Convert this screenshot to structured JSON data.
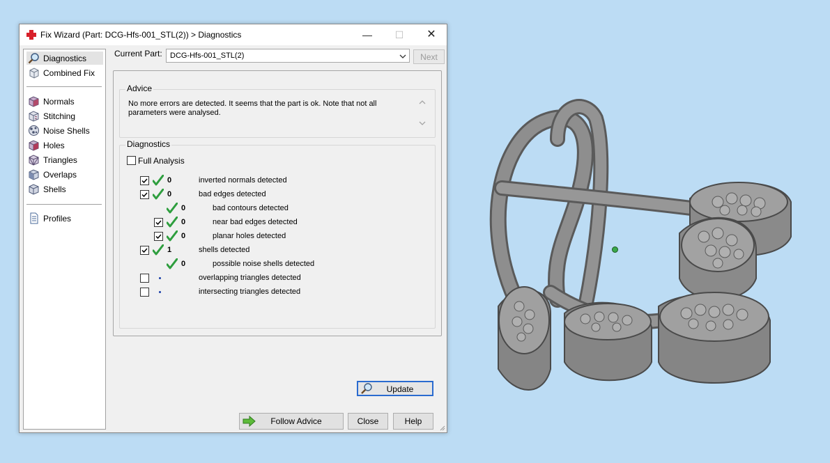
{
  "window": {
    "title": "Fix Wizard (Part: DCG-Hfs-001_STL(2)) > Diagnostics",
    "controls": {
      "minimize": "—",
      "maximize": "☐",
      "close": "✕"
    }
  },
  "sidebar": {
    "items": [
      {
        "label": "Diagnostics",
        "icon": "magnifier-icon",
        "selected": true
      },
      {
        "label": "Combined Fix",
        "icon": "cube-icon"
      },
      {
        "label": "Normals",
        "icon": "normals-cube-icon"
      },
      {
        "label": "Stitching",
        "icon": "stitching-cube-icon"
      },
      {
        "label": "Noise Shells",
        "icon": "noise-shells-icon"
      },
      {
        "label": "Holes",
        "icon": "holes-cube-icon"
      },
      {
        "label": "Triangles",
        "icon": "triangles-cube-icon"
      },
      {
        "label": "Overlaps",
        "icon": "overlaps-cube-icon"
      },
      {
        "label": "Shells",
        "icon": "shells-cube-icon"
      },
      {
        "label": "Profiles",
        "icon": "document-icon"
      }
    ]
  },
  "current_part": {
    "label": "Current Part:",
    "value": "DCG-Hfs-001_STL(2)",
    "next_label": "Next"
  },
  "advice": {
    "title": "Advice",
    "text": "No more errors are detected. It seems that the part is ok. Note that not all parameters were analysed."
  },
  "diagnostics": {
    "title": "Diagnostics",
    "full_analysis_label": "Full Analysis",
    "full_analysis_checked": false,
    "rows": [
      {
        "checkbox": true,
        "checked": true,
        "status": "ok",
        "count": "0",
        "label": "inverted normals detected",
        "indent": 0
      },
      {
        "checkbox": true,
        "checked": true,
        "status": "ok",
        "count": "0",
        "label": "bad edges detected",
        "indent": 0
      },
      {
        "checkbox": false,
        "checked": false,
        "status": "ok",
        "count": "0",
        "label": "bad contours detected",
        "indent": 1
      },
      {
        "checkbox": true,
        "checked": true,
        "status": "ok",
        "count": "0",
        "label": "near bad edges detected",
        "indent": 1
      },
      {
        "checkbox": true,
        "checked": true,
        "status": "ok",
        "count": "0",
        "label": "planar holes detected",
        "indent": 1
      },
      {
        "checkbox": true,
        "checked": true,
        "status": "ok",
        "count": "1",
        "label": "shells detected",
        "indent": 0
      },
      {
        "checkbox": false,
        "checked": false,
        "status": "ok",
        "count": "0",
        "label": "possible noise shells detected",
        "indent": 1
      },
      {
        "checkbox": true,
        "checked": false,
        "status": "unknown",
        "count": "",
        "label": "overlapping triangles detected",
        "indent": 0
      },
      {
        "checkbox": true,
        "checked": false,
        "status": "unknown",
        "count": "",
        "label": "intersecting triangles detected",
        "indent": 0
      }
    ],
    "update_label": "Update"
  },
  "buttons": {
    "follow_advice": "Follow Advice",
    "close": "Close",
    "help": "Help"
  },
  "colors": {
    "background": "#bcdcf4",
    "ok_tick": "#2e9e3e",
    "accent": "#2a6bd0",
    "model": "#8c8c8c"
  }
}
